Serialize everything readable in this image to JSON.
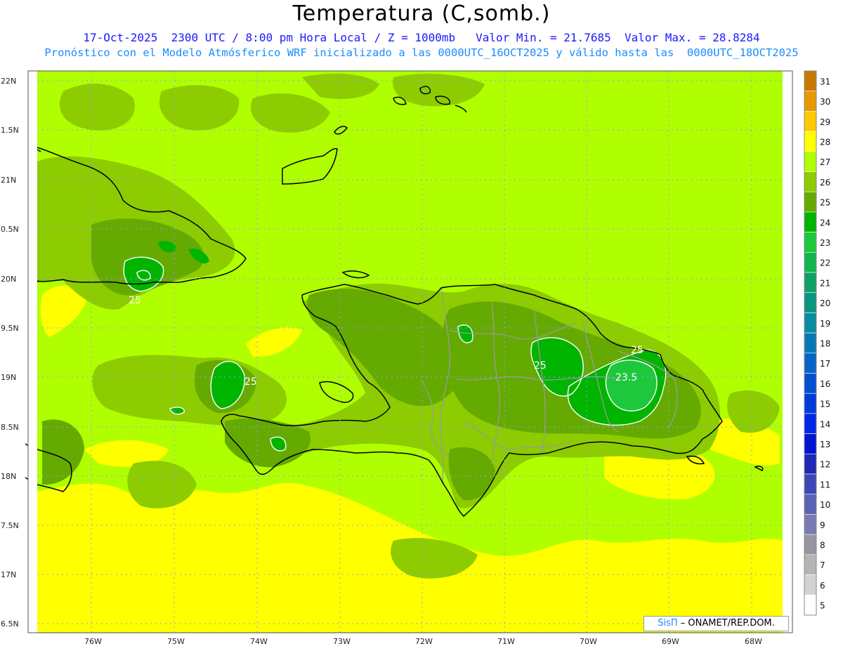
{
  "header": {
    "title": "Temperatura (C,somb.)",
    "line1": "17-Oct-2025  2300 UTC / 8:00 pm Hora Local / Z = 1000mb   Valor Min. = 21.7685  Valor Max. = 28.8284",
    "line2": "Pronóstico con el Modelo Atmósferico WRF inicializado a las 0000UTC_16OCT2025 y válido hasta las  0000UTC_18OCT2025"
  },
  "axes": {
    "lat_labels": [
      "22N",
      "1.5N",
      "21N",
      "0.5N",
      "20N",
      "9.5N",
      "19N",
      "8.5N",
      "18N",
      "7.5N",
      "17N",
      "6.5N"
    ],
    "lon_labels": [
      "76W",
      "75W",
      "74W",
      "73W",
      "72W",
      "71W",
      "70W",
      "69W",
      "68W"
    ]
  },
  "colorbar": {
    "labels": [
      "31",
      "30",
      "29",
      "28",
      "27",
      "26",
      "25",
      "24",
      "23",
      "22",
      "21",
      "20",
      "19",
      "18",
      "17",
      "16",
      "15",
      "14",
      "13",
      "12",
      "11",
      "10",
      "9",
      "8",
      "7",
      "6",
      "5"
    ],
    "colors": [
      "#c87800",
      "#e69a00",
      "#ffc800",
      "#ffff00",
      "#b0ff00",
      "#8ccc00",
      "#64aa00",
      "#00b400",
      "#1ec83c",
      "#14b450",
      "#10a064",
      "#0c9682",
      "#0a8ca0",
      "#0878b4",
      "#0664c8",
      "#0050d2",
      "#003cdc",
      "#0028e6",
      "#0014d2",
      "#1e28b4",
      "#3c46b4",
      "#5a64b4",
      "#7a7ab4",
      "#9696a0",
      "#b4b4b4",
      "#d2d2d2",
      "#ffffff"
    ]
  },
  "contours": {
    "labels": [
      "25",
      "25",
      "25",
      "25",
      "23.5"
    ]
  },
  "credit": {
    "brand": "SisΠ",
    "text": "– ONAMET/REP.DOM."
  },
  "colors": {
    "base_field": "#b0ff00",
    "warm_field": "#ffff00",
    "mid_field": "#8ccc00",
    "cool_field": "#64aa00",
    "cold_field": "#00b400",
    "coast": "#000000",
    "province_borders": "#9a9a9a",
    "grid": "#9a9aff"
  }
}
